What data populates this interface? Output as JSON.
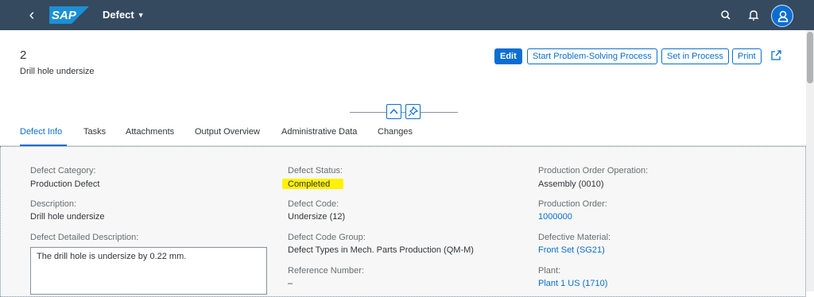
{
  "shell": {
    "logo_text": "SAP",
    "app_title": "Defect",
    "icons": [
      "back-icon",
      "search-icon",
      "bell-icon",
      "user-icon"
    ],
    "colors": {
      "shell_bg": "#354a5f",
      "accent": "#0a6ed1"
    }
  },
  "header": {
    "object_number": "2",
    "object_subtitle": "Drill hole undersize",
    "actions": {
      "edit": "Edit",
      "start_problem_solving": "Start Problem-Solving Process",
      "set_in_process": "Set in Process",
      "print": "Print"
    }
  },
  "tabs": [
    {
      "label": "Defect Info",
      "active": true
    },
    {
      "label": "Tasks"
    },
    {
      "label": "Attachments"
    },
    {
      "label": "Output Overview"
    },
    {
      "label": "Administrative Data"
    },
    {
      "label": "Changes"
    }
  ],
  "fields": {
    "defect_category": {
      "label": "Defect Category:",
      "value": "Production Defect"
    },
    "description": {
      "label": "Description:",
      "value": "Drill hole undersize"
    },
    "detailed_description": {
      "label": "Defect Detailed Description:",
      "value": "The drill hole is undersize by 0.22 mm."
    },
    "defect_status": {
      "label": "Defect Status:",
      "value": "Completed"
    },
    "defect_code": {
      "label": "Defect Code:",
      "value": "Undersize (12)"
    },
    "defect_code_group": {
      "label": "Defect Code Group:",
      "value": "Defect Types in Mech. Parts Production (QM-M)"
    },
    "reference_number": {
      "label": "Reference Number:",
      "value": "–"
    },
    "production_order_operation": {
      "label": "Production Order Operation:",
      "value": "Assembly (0010)"
    },
    "production_order": {
      "label": "Production Order:",
      "value": "1000000"
    },
    "defective_material": {
      "label": "Defective Material:",
      "value": "Front Set (SG21)"
    },
    "plant": {
      "label": "Plant:",
      "value": "Plant 1 US (1710)"
    }
  }
}
